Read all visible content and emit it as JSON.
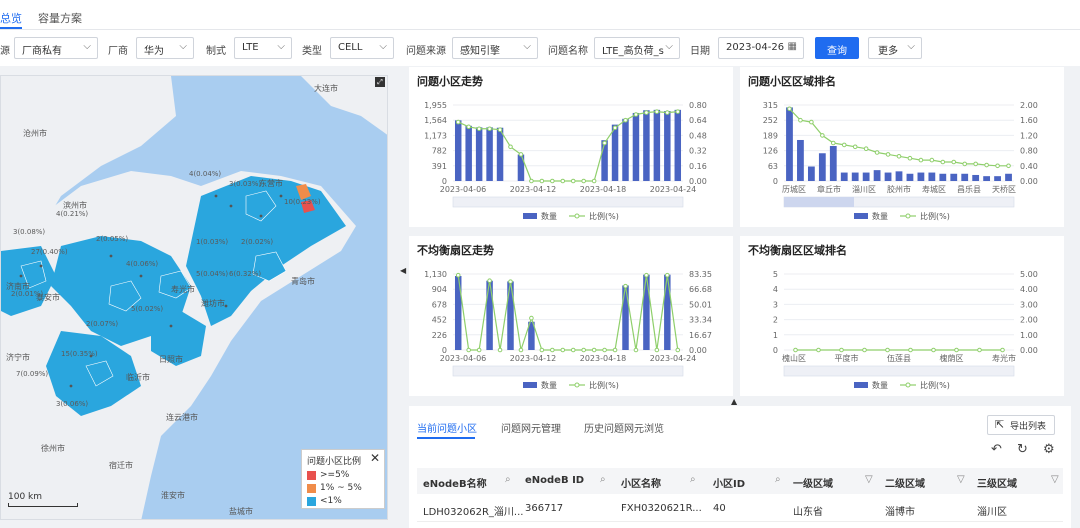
{
  "nav": {
    "tabs": [
      "总览",
      "容量方案"
    ]
  },
  "filters": {
    "source_label": "源",
    "source_value": "厂商私有",
    "vendor_label": "厂商",
    "vendor_value": "华为",
    "standard_label": "制式",
    "standard_value": "LTE",
    "type_label": "类型",
    "type_value": "CELL",
    "issue_source_label": "问题来源",
    "issue_source_value": "感知引擎",
    "issue_name_label": "问题名称",
    "issue_name_value": "LTE_高负荷_s",
    "date_label": "日期",
    "date_value": "2023-04-26",
    "query_button": "查询",
    "more_button": "更多"
  },
  "map": {
    "legend_title": "问题小区比例",
    "legend_items": [
      {
        "label": ">=5%",
        "color": "#e8514e"
      },
      {
        "label": "1% ~ 5%",
        "color": "#f08c4a"
      },
      {
        "label": "<1%",
        "color": "#2aa6de"
      }
    ],
    "scale_label": "100 km",
    "place_labels": [
      "大连市",
      "沧州市",
      "滨州市",
      "东营市",
      "寿光市",
      "潍坊市",
      "青岛市",
      "济南市",
      "泰安市",
      "济宁市",
      "徐州市",
      "临沂市",
      "日照市",
      "连云港市",
      "宿迁市",
      "淮安市",
      "盐城市"
    ]
  },
  "charts": [
    {
      "title": "问题小区走势",
      "type": "bar",
      "x_ticks": [
        "2023-04-06",
        "2023-04-12",
        "2023-04-18",
        "2023-04-24"
      ],
      "y_left_ticks": [
        "0",
        "391",
        "782",
        "1,173",
        "1,564",
        "1,955"
      ],
      "y_right_ticks": [
        "0.00",
        "0.16",
        "0.32",
        "0.48",
        "0.64",
        "0.80"
      ],
      "legend": [
        "数量",
        "比例(%)"
      ],
      "series": [
        {
          "name": "数量",
          "values": [
            1560,
            1420,
            1380,
            1380,
            1370,
            0,
            680,
            0,
            0,
            0,
            0,
            0,
            0,
            0,
            1050,
            1450,
            1600,
            1750,
            1820,
            1830,
            1800,
            1830
          ]
        },
        {
          "name": "比例(%)",
          "values": [
            0.62,
            0.57,
            0.55,
            0.55,
            0.54,
            0.36,
            0.28,
            0.0,
            0.0,
            0.0,
            0.0,
            0.0,
            0.0,
            0.0,
            0.4,
            0.56,
            0.64,
            0.7,
            0.72,
            0.73,
            0.72,
            0.73
          ]
        }
      ],
      "ylim": [
        0,
        1955
      ]
    },
    {
      "title": "问题小区区域排名",
      "type": "bar",
      "x_ticks": [
        "历城区",
        "章丘市",
        "淄川区",
        "胶州市",
        "寿城区",
        "昌乐县",
        "天桥区"
      ],
      "y_left_ticks": [
        "0",
        "63",
        "126",
        "189",
        "252",
        "315"
      ],
      "y_right_ticks": [
        "0.00",
        "0.40",
        "0.80",
        "1.20",
        "1.60",
        "2.00"
      ],
      "legend": [
        "数量",
        "比例(%)"
      ],
      "series": [
        {
          "name": "数量",
          "values": [
            305,
            170,
            60,
            115,
            145,
            35,
            35,
            35,
            45,
            35,
            40,
            30,
            35,
            35,
            30,
            30,
            30,
            25,
            20,
            20,
            30
          ]
        },
        {
          "name": "比例(%)",
          "values": [
            1.9,
            1.6,
            1.55,
            1.2,
            1.0,
            0.95,
            0.9,
            0.85,
            0.75,
            0.7,
            0.65,
            0.6,
            0.55,
            0.55,
            0.5,
            0.5,
            0.45,
            0.45,
            0.42,
            0.4,
            0.4
          ]
        }
      ],
      "ylim": [
        0,
        315
      ]
    },
    {
      "title": "不均衡扇区走势",
      "type": "bar",
      "x_ticks": [
        "2023-04-06",
        "2023-04-12",
        "2023-04-18",
        "2023-04-24"
      ],
      "y_left_ticks": [
        "0",
        "226",
        "452",
        "678",
        "904",
        "1,130"
      ],
      "y_right_ticks": [
        "0.00",
        "16.67",
        "33.34",
        "50.01",
        "66.68",
        "83.35"
      ],
      "legend": [
        "数量",
        "比例(%)"
      ],
      "series": [
        {
          "name": "数量",
          "values": [
            1100,
            0,
            0,
            1030,
            0,
            1020,
            0,
            420,
            0,
            0,
            0,
            0,
            0,
            0,
            0,
            0,
            960,
            0,
            1120,
            0,
            1120,
            0
          ]
        },
        {
          "name": "比例(%)",
          "values": [
            82,
            0,
            0,
            76,
            0,
            75,
            0,
            35,
            0,
            0,
            0,
            0,
            0,
            0,
            0,
            0,
            70,
            0,
            82,
            0,
            82,
            0
          ]
        }
      ],
      "ylim": [
        0,
        1130
      ]
    },
    {
      "title": "不均衡扇区区域排名",
      "type": "bar",
      "x_ticks": [
        "槐山区",
        "平度市",
        "伍莲县",
        "槐荫区",
        "寿光市"
      ],
      "y_left_ticks": [
        "0",
        "1",
        "2",
        "3",
        "4",
        "5"
      ],
      "y_right_ticks": [
        "0.00",
        "1.00",
        "2.00",
        "3.00",
        "4.00",
        "5.00"
      ],
      "legend": [
        "数量",
        "比例(%)"
      ],
      "series": [
        {
          "name": "数量",
          "values": [
            0,
            0,
            0,
            0,
            0,
            0,
            0,
            0,
            0,
            0
          ]
        },
        {
          "name": "比例(%)",
          "values": [
            0,
            0,
            0,
            0,
            0,
            0,
            0,
            0,
            0,
            0
          ]
        }
      ],
      "ylim": [
        0,
        5
      ]
    }
  ],
  "bottom": {
    "tabs": [
      "当前问题小区",
      "问题网元管理",
      "历史问题网元浏览"
    ],
    "export_label": "导出列表",
    "columns": [
      "eNodeB名称",
      "eNodeB ID",
      "小区名称",
      "小区ID",
      "一级区域",
      "二级区域",
      "三级区域"
    ],
    "rows": [
      [
        "LDH032062R_淄川...",
        "366717",
        "FXH0320621R...",
        "40",
        "山东省",
        "淄博市",
        "淄川区"
      ]
    ]
  },
  "colors": {
    "accent": "#1f6cf0",
    "bar": "#4a64c2",
    "line": "#8fcf6b"
  }
}
